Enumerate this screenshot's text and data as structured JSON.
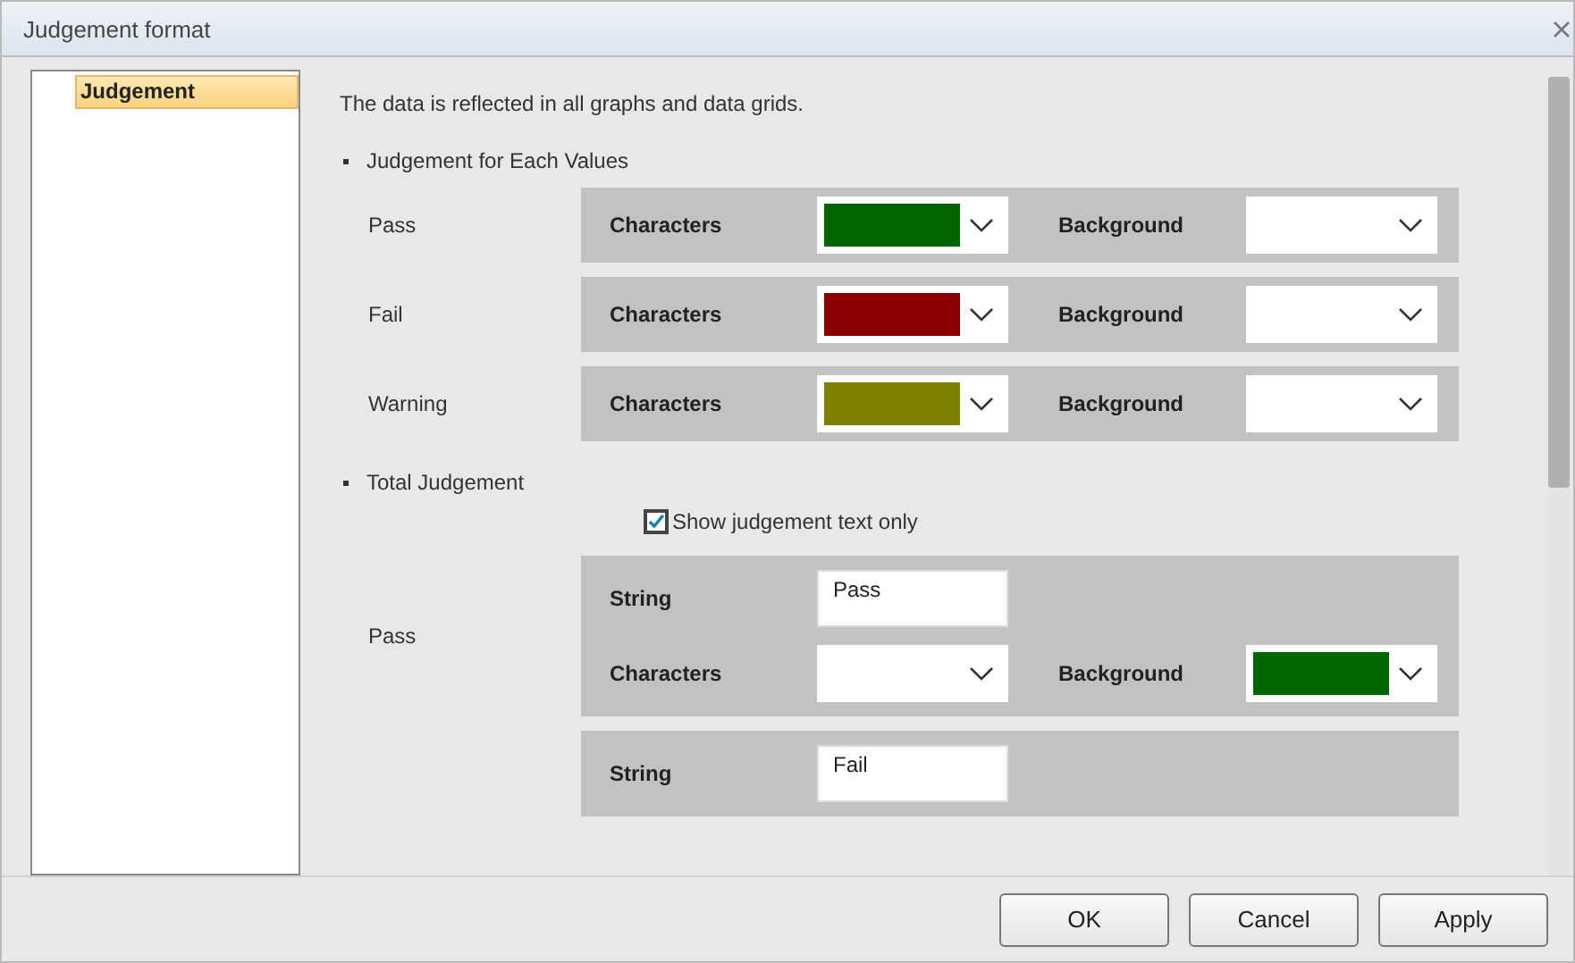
{
  "window": {
    "title": "Judgement format"
  },
  "sidebar": {
    "items": [
      {
        "label": "Judgement",
        "selected": true
      }
    ]
  },
  "description": "The data is reflected in all graphs and data grids.",
  "each_values": {
    "heading": "Judgement for Each Values",
    "rows": [
      {
        "label": "Pass",
        "characters": {
          "label": "Characters",
          "color": "#006400"
        },
        "background": {
          "label": "Background"
        }
      },
      {
        "label": "Fail",
        "characters": {
          "label": "Characters",
          "color": "#8b0000"
        },
        "background": {
          "label": "Background"
        }
      },
      {
        "label": "Warning",
        "characters": {
          "label": "Characters",
          "color": "#808000"
        },
        "background": {
          "label": "Background"
        }
      }
    ]
  },
  "total": {
    "heading": "Total Judgement",
    "checkbox": {
      "label": "Show judgement text only",
      "checked": true
    },
    "rows": [
      {
        "label": "Pass",
        "string_label": "String",
        "string_value": "Pass",
        "characters": {
          "label": "Characters"
        },
        "background": {
          "label": "Background",
          "color": "#006400"
        }
      },
      {
        "string_label": "String",
        "string_value": "Fail"
      }
    ]
  },
  "buttons": [
    "OK",
    "Cancel",
    "Apply"
  ]
}
